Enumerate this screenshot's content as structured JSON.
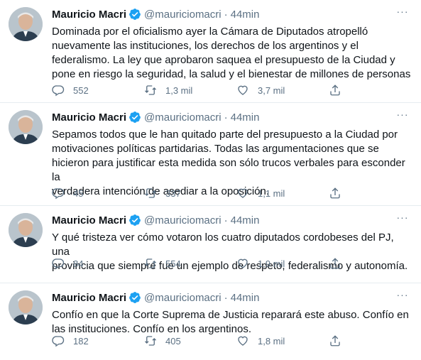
{
  "tweets": [
    {
      "name": "Mauricio Macri",
      "handle": "@mauriciomacri",
      "separator": "·",
      "time": "44min",
      "text": "Dominada por el oficialismo ayer la Cámara de Diputados atropelló\nnuevamente las instituciones, los derechos de los argentinos y el\nfederalismo. La ley que aprobaron saquea el presupuesto de la Ciudad y\npone en riesgo la seguridad, la salud y el bienestar de millones de personas",
      "replies": "552",
      "retweets": "1,3 mil",
      "likes": "3,7 mil"
    },
    {
      "name": "Mauricio Macri",
      "handle": "@mauriciomacri",
      "separator": "·",
      "time": "44min",
      "text": "Sepamos todos que le han quitado parte del presupuesto a la Ciudad por\nmotivaciones políticas partidarias. Todas las argumentaciones que se\nhicieron para justificar esta medida son sólo trucos verbales para esconder la\nverdadera intención de asediar a la oposición.",
      "replies": "45",
      "retweets": "337",
      "likes": "1,1 mil"
    },
    {
      "name": "Mauricio Macri",
      "handle": "@mauriciomacri",
      "separator": "·",
      "time": "44min",
      "text": "Y qué tristeza ver cómo votaron los cuatro diputados cordobeses del PJ, una\nprovincia que siempre fue un ejemplo de respeto, federalismo y autonomía.",
      "replies": "84",
      "retweets": "554",
      "likes": "1,9 mil"
    },
    {
      "name": "Mauricio Macri",
      "handle": "@mauriciomacri",
      "separator": "·",
      "time": "44min",
      "text": "Confío en que la Corte Suprema de Justicia reparará este abuso. Confío en\nlas instituciones. Confío en los argentinos.",
      "replies": "182",
      "retweets": "405",
      "likes": "1,8 mil"
    }
  ],
  "ui": {
    "more_label": "···",
    "icons": [
      "reply-icon",
      "retweet-icon",
      "like-icon",
      "share-icon",
      "verified-badge-icon",
      "more-icon"
    ],
    "colors": {
      "text": "#0f1419",
      "secondary": "#5b7083",
      "verified": "#1da1f2",
      "divider": "#e6ecf0"
    }
  }
}
